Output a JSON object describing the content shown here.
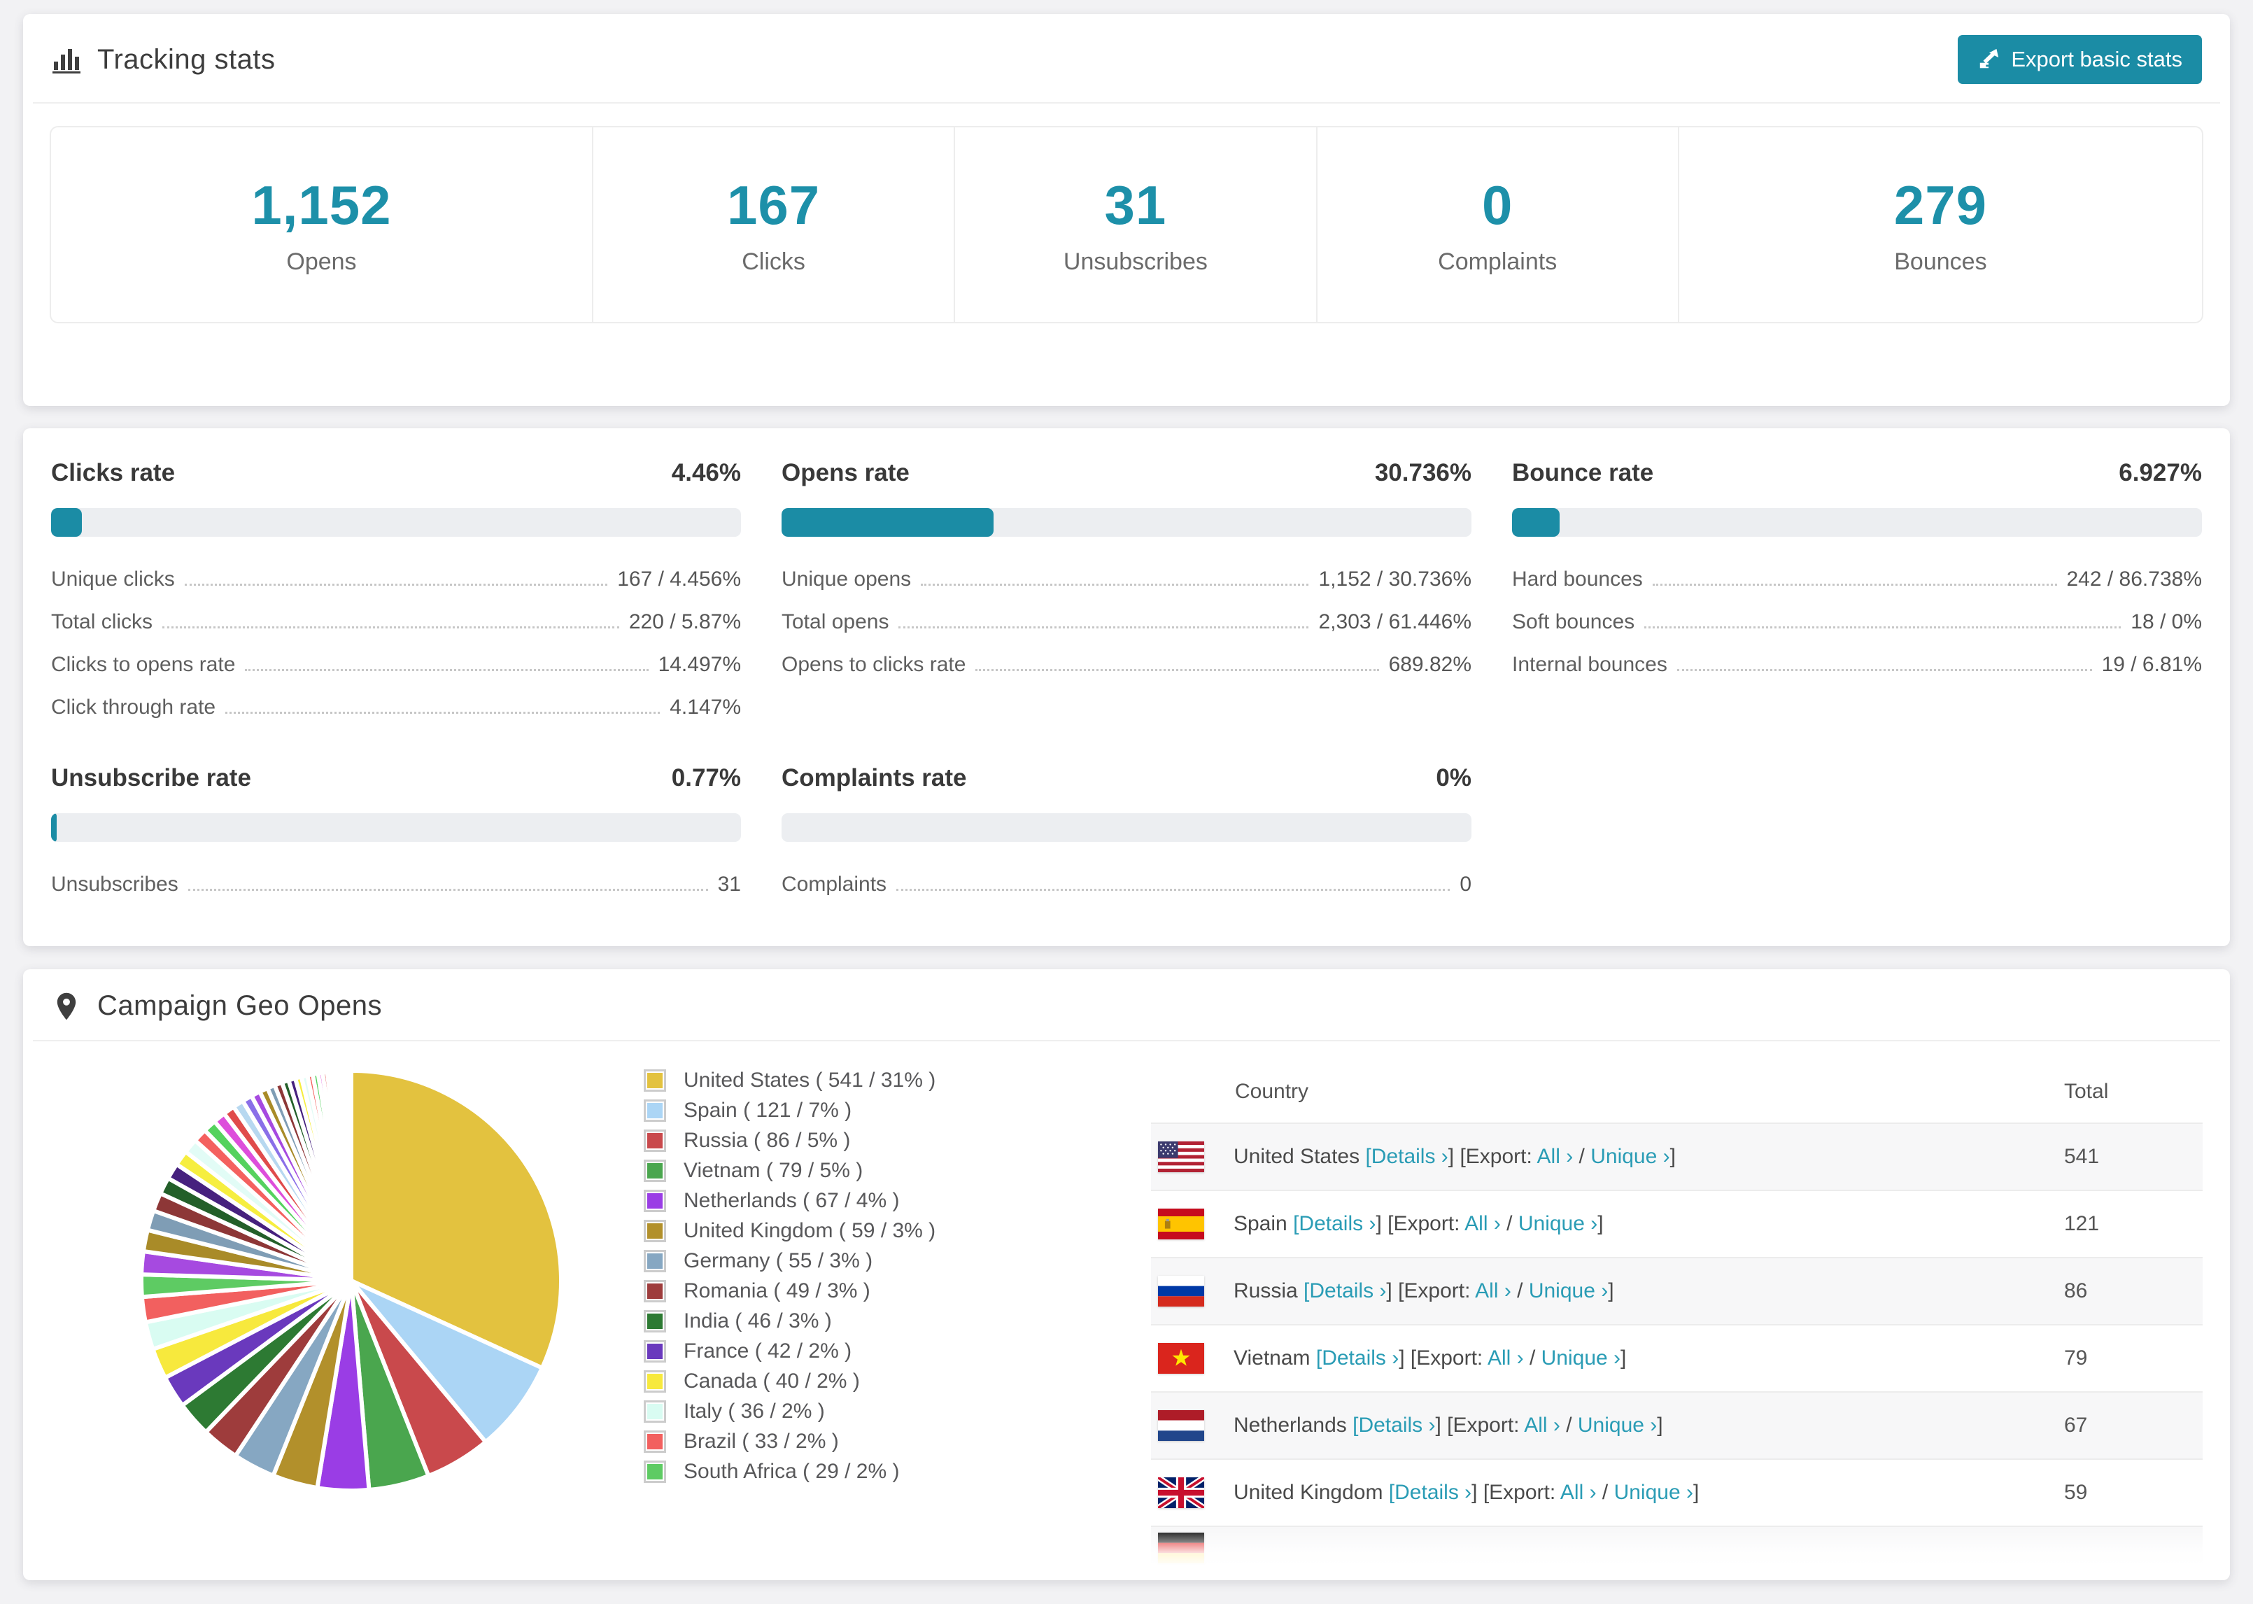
{
  "colors": {
    "teal": "#1b8ca5",
    "link": "#2a9cb5",
    "stat_number": "#1d90a9",
    "bar_track": "#eceef1",
    "page_bg": "#f2f2f4",
    "striped_row": "#f7f7f8"
  },
  "tracking": {
    "title": "Tracking stats",
    "title_icon": "bar-chart-icon",
    "export_button": {
      "label": "Export basic stats",
      "icon": "export-icon"
    },
    "stats": [
      {
        "value": "1,152",
        "label": "Opens"
      },
      {
        "value": "167",
        "label": "Clicks"
      },
      {
        "value": "31",
        "label": "Unsubscribes"
      },
      {
        "value": "0",
        "label": "Complaints"
      },
      {
        "value": "279",
        "label": "Bounces"
      }
    ]
  },
  "rates": {
    "panels": [
      {
        "title": "Clicks rate",
        "value": "4.46%",
        "bar_pct": 4.46,
        "rows": [
          {
            "label": "Unique clicks",
            "value": "167 / 4.456%"
          },
          {
            "label": "Total clicks",
            "value": "220 / 5.87%"
          },
          {
            "label": "Clicks to opens rate",
            "value": "14.497%"
          },
          {
            "label": "Click through rate",
            "value": "4.147%"
          }
        ]
      },
      {
        "title": "Opens rate",
        "value": "30.736%",
        "bar_pct": 30.736,
        "rows": [
          {
            "label": "Unique opens",
            "value": "1,152 / 30.736%"
          },
          {
            "label": "Total opens",
            "value": "2,303 / 61.446%"
          },
          {
            "label": "Opens to clicks rate",
            "value": "689.82%"
          }
        ]
      },
      {
        "title": "Bounce rate",
        "value": "6.927%",
        "bar_pct": 6.927,
        "rows": [
          {
            "label": "Hard bounces",
            "value": "242 / 86.738%"
          },
          {
            "label": "Soft bounces",
            "value": "18 / 0%"
          },
          {
            "label": "Internal bounces",
            "value": "19 / 6.81%"
          }
        ]
      },
      {
        "title": "Unsubscribe rate",
        "value": "0.77%",
        "bar_pct": 0.77,
        "rows": [
          {
            "label": "Unsubscribes",
            "value": "31"
          }
        ]
      },
      {
        "title": "Complaints rate",
        "value": "0%",
        "bar_pct": 0,
        "rows": [
          {
            "label": "Complaints",
            "value": "0"
          }
        ]
      }
    ]
  },
  "chart_data": {
    "type": "pie",
    "title": "Campaign Geo Opens",
    "unit": "opens",
    "start_angle_deg": -90,
    "direction": "clockwise",
    "legend_position": "right",
    "slices": [
      {
        "label": "United States",
        "value": 541,
        "pct": "31%",
        "color": "#e3c23f",
        "display": "United States ( 541 / 31% )"
      },
      {
        "label": "Spain",
        "value": 121,
        "pct": "7%",
        "color": "#abd5f5",
        "display": "Spain ( 121 / 7% )"
      },
      {
        "label": "Russia",
        "value": 86,
        "pct": "5%",
        "color": "#c9494c",
        "display": "Russia ( 86 / 5% )"
      },
      {
        "label": "Vietnam",
        "value": 79,
        "pct": "5%",
        "color": "#4aa64e",
        "display": "Vietnam ( 79 / 5% )"
      },
      {
        "label": "Netherlands",
        "value": 67,
        "pct": "4%",
        "color": "#9a3de5",
        "display": "Netherlands ( 67 / 4% )"
      },
      {
        "label": "United Kingdom",
        "value": 59,
        "pct": "3%",
        "color": "#b2902b",
        "display": "United Kingdom ( 59 / 3% )"
      },
      {
        "label": "Germany",
        "value": 55,
        "pct": "3%",
        "color": "#86a7c2",
        "display": "Germany ( 55 / 3% )"
      },
      {
        "label": "Romania",
        "value": 49,
        "pct": "3%",
        "color": "#9e3c3c",
        "display": "Romania ( 49 / 3% )"
      },
      {
        "label": "India",
        "value": 46,
        "pct": "3%",
        "color": "#2d7a33",
        "display": "India ( 46 / 3% )"
      },
      {
        "label": "France",
        "value": 42,
        "pct": "2%",
        "color": "#6a39bd",
        "display": "France ( 42 / 2% )"
      },
      {
        "label": "Canada",
        "value": 40,
        "pct": "2%",
        "color": "#f7e93d",
        "display": "Canada ( 40 / 2% )"
      },
      {
        "label": "Italy",
        "value": 36,
        "pct": "2%",
        "color": "#d9fcf2",
        "display": "Italy ( 36 / 2% )"
      },
      {
        "label": "Brazil",
        "value": 33,
        "pct": "2%",
        "color": "#f2605f",
        "display": "Brazil ( 33 / 2% )"
      },
      {
        "label": "South Africa",
        "value": 29,
        "pct": "2%",
        "color": "#5ecb63",
        "display": "South Africa ( 29 / 2% )"
      }
    ],
    "unlabeled_slices_estimated": {
      "values": [
        30,
        28,
        26,
        24,
        22,
        21,
        20,
        19,
        18,
        17,
        16,
        15,
        14,
        13,
        12,
        11,
        10,
        10,
        9,
        9,
        8,
        8,
        7,
        7,
        6,
        6,
        5,
        5,
        4,
        4,
        3,
        3,
        2,
        2,
        2,
        1
      ],
      "palette": [
        "#a64ae0",
        "#a98b28",
        "#7f9db5",
        "#8d3737",
        "#235f29",
        "#46217e",
        "#f6ee3f",
        "#e2fcf6",
        "#f4615f",
        "#55d25e",
        "#dd4edb",
        "#e04b4b",
        "#b7d8f0",
        "#8a6fe8"
      ]
    }
  },
  "geo": {
    "title": "Campaign Geo Opens",
    "title_icon": "map-pin-icon",
    "table": {
      "columns": [
        "Country",
        "Total"
      ],
      "link_labels": {
        "lb": "[",
        "rb": "]",
        "details": "Details",
        "export": "Export:",
        "all": "All",
        "unique": "Unique",
        "arrow": "›",
        "slash": "/"
      },
      "rows": [
        {
          "country": "United States",
          "flag": "us",
          "total": "541"
        },
        {
          "country": "Spain",
          "flag": "es",
          "total": "121"
        },
        {
          "country": "Russia",
          "flag": "ru",
          "total": "86"
        },
        {
          "country": "Vietnam",
          "flag": "vn",
          "total": "79"
        },
        {
          "country": "Netherlands",
          "flag": "nl",
          "total": "67"
        },
        {
          "country": "United Kingdom",
          "flag": "gb",
          "total": "59"
        },
        {
          "country": "",
          "flag": "de",
          "total": "",
          "partial": true
        }
      ]
    }
  }
}
